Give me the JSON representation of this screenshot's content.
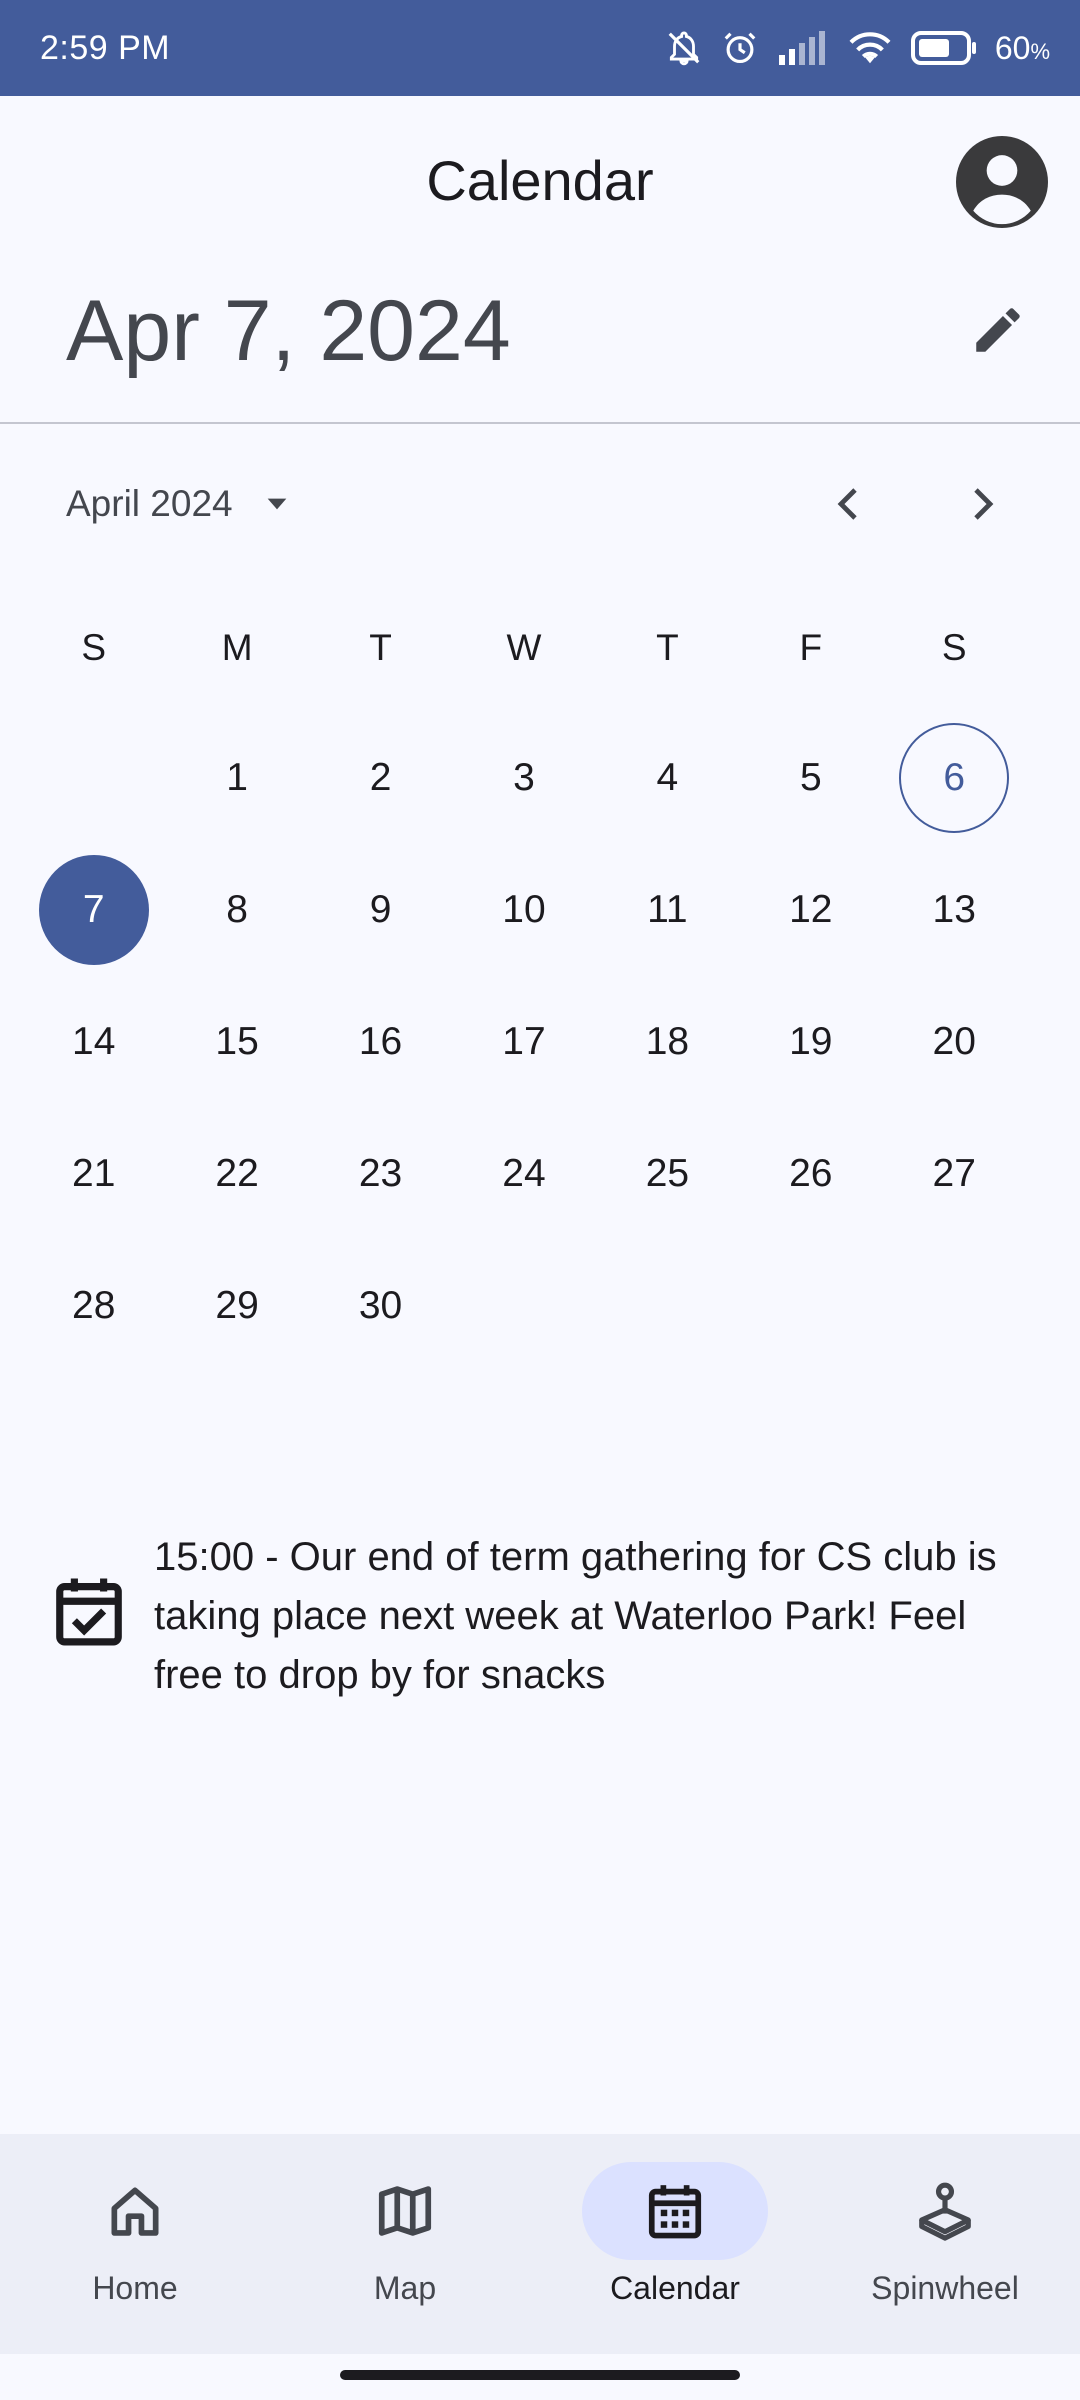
{
  "status_bar": {
    "time": "2:59 PM",
    "battery_percent": "60",
    "battery_unit": "%",
    "icons": [
      "bell-off-icon",
      "alarm-icon",
      "signal-icon",
      "wifi-icon",
      "battery-icon"
    ]
  },
  "app_bar": {
    "title": "Calendar",
    "avatar_icon": "account-circle-icon"
  },
  "header": {
    "selected_date": "Apr 7, 2024",
    "edit_icon": "pencil-icon"
  },
  "month_picker": {
    "label": "April 2024",
    "dropdown_icon": "caret-down-icon",
    "prev_icon": "chevron-left-icon",
    "next_icon": "chevron-right-icon"
  },
  "calendar": {
    "weekdays": [
      "S",
      "M",
      "T",
      "W",
      "T",
      "F",
      "S"
    ],
    "today": "6",
    "selected": "7",
    "weeks": [
      [
        "",
        "1",
        "2",
        "3",
        "4",
        "5",
        "6"
      ],
      [
        "7",
        "8",
        "9",
        "10",
        "11",
        "12",
        "13"
      ],
      [
        "14",
        "15",
        "16",
        "17",
        "18",
        "19",
        "20"
      ],
      [
        "21",
        "22",
        "23",
        "24",
        "25",
        "26",
        "27"
      ],
      [
        "28",
        "29",
        "30",
        "",
        "",
        "",
        ""
      ]
    ]
  },
  "event": {
    "icon": "event-available-icon",
    "text": "15:00 - Our end of term gathering for CS club is taking place next week at Waterloo Park! Feel free to drop by for snacks"
  },
  "bottom_nav": {
    "items": [
      {
        "label": "Home",
        "icon": "home-icon",
        "active": false
      },
      {
        "label": "Map",
        "icon": "map-icon",
        "active": false
      },
      {
        "label": "Calendar",
        "icon": "calendar-icon",
        "active": true
      },
      {
        "label": "Spinwheel",
        "icon": "joystick-icon",
        "active": false
      }
    ]
  },
  "colors": {
    "primary": "#435c9b",
    "background": "#f8f9ff",
    "nav_background": "#eceef7",
    "nav_indicator": "#dbe1ff"
  }
}
